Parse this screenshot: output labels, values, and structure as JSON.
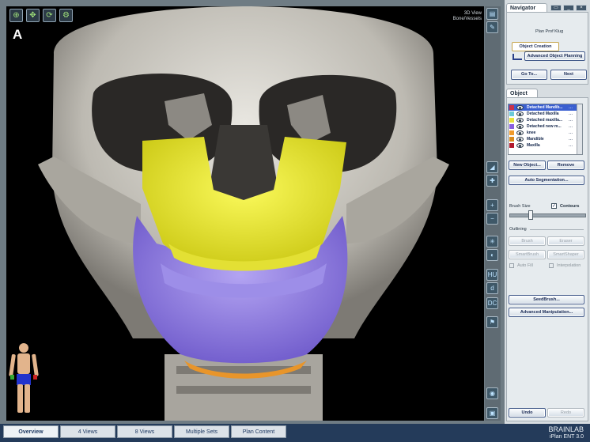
{
  "viewport": {
    "label": "A",
    "view_name": "3D View",
    "view_mode": "Bone/Vessels",
    "tool_icons": [
      "zoom-icon",
      "pan-icon",
      "rotate-icon",
      "settings-icon"
    ]
  },
  "navigator": {
    "title": "Navigator",
    "plan_name": "Plan Prof Klug",
    "steps": [
      "Object Creation",
      "Advanced Object Planning"
    ],
    "goto_label": "Go To...",
    "next_label": "Next"
  },
  "object": {
    "title": "Object",
    "items": [
      {
        "name": "Detached Mandib...",
        "color": "#c8324a",
        "selected": true
      },
      {
        "name": "Detached Maxilla",
        "color": "#6ccad8",
        "selected": false
      },
      {
        "name": "Detached maxilla...",
        "color": "#e8e33a",
        "selected": false
      },
      {
        "name": "Detached new m...",
        "color": "#8a5fe0",
        "selected": false
      },
      {
        "name": "knee",
        "color": "#f09a2a",
        "selected": false
      },
      {
        "name": "Mandible",
        "color": "#d98a1a",
        "selected": false
      },
      {
        "name": "Maxilla",
        "color": "#b0182c",
        "selected": false
      }
    ],
    "row_more": "...",
    "new_object_label": "New Object...",
    "remove_label": "Remove",
    "auto_segmentation_label": "Auto Segmentation...",
    "brush_size_label": "Brush Size",
    "contours_label": "Contours",
    "contours_checked": true,
    "outlining_label": "Outlining",
    "brush_label": "Brush",
    "eraser_label": "Eraser",
    "smartbrush_label": "SmartBrush",
    "smartshaper_label": "SmartShaper",
    "autofill_label": "Auto Fill",
    "interpolation_label": "Interpolation",
    "seedbrush_label": "SeedBrush...",
    "advanced_manipulation_label": "Advanced Manipulation...",
    "undo_label": "Undo",
    "redo_label": "Redo"
  },
  "bottom_tabs": [
    "Overview",
    "4 Views",
    "8 Views",
    "Multiple Sets",
    "Plan Content"
  ],
  "active_tab": "Overview",
  "brand": {
    "name": "BRAINLAB",
    "product": "iPlan ENT 3.0"
  }
}
